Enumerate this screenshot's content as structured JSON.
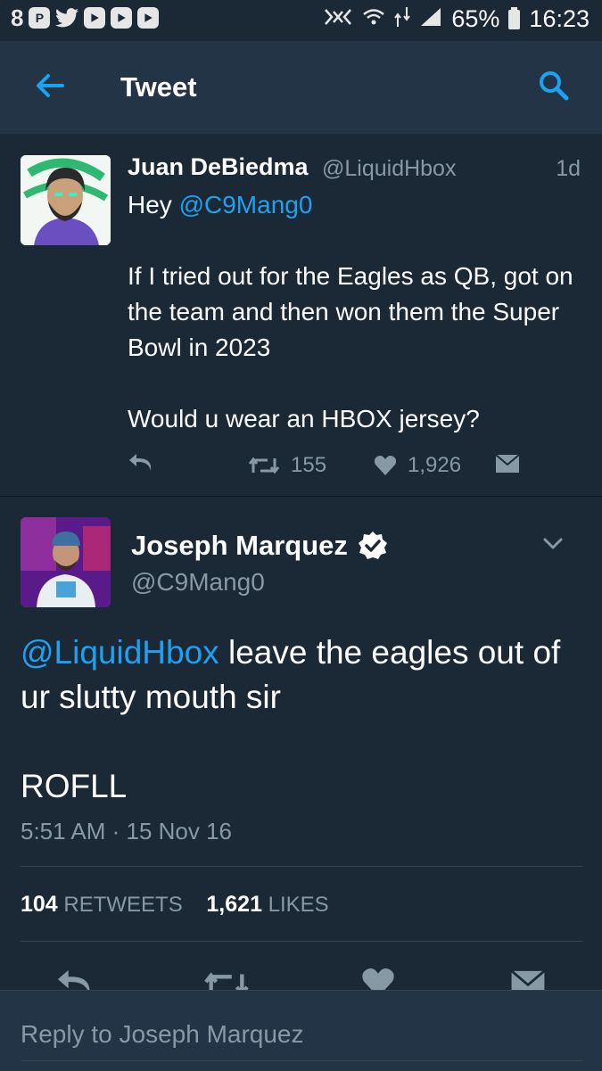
{
  "status_bar": {
    "apps": [
      "8",
      "P",
      "twitter",
      "youtube",
      "youtube",
      "youtube"
    ],
    "battery": "65%",
    "time": "16:23"
  },
  "app_bar": {
    "title": "Tweet",
    "icons": [
      "back-arrow-icon",
      "search-icon"
    ]
  },
  "parent_tweet": {
    "name": "Juan DeBiedma",
    "handle": "@LiquidHbox",
    "time": "1d",
    "body_prefix": "Hey ",
    "mention": "@C9Mang0",
    "paragraph_2": "If I tried out for the Eagles as QB, got on the team and then won them the Super Bowl in 2023",
    "paragraph_3": "Would u wear an HBOX jersey?",
    "retweets": "155",
    "likes": "1,926"
  },
  "main_tweet": {
    "name": "Joseph Marquez",
    "handle": "@C9Mang0",
    "mention": "@LiquidHbox",
    "body_rest": " leave the eagles out of ur slutty mouth sir",
    "paragraph_2": "ROFLL",
    "timestamp": "5:51 AM · 15 Nov 16",
    "retweet_count": "104",
    "retweet_label": "RETWEETS",
    "like_count": "1,621",
    "like_label": "LIKES"
  },
  "reply": {
    "placeholder": "Reply to Joseph Marquez"
  },
  "colors": {
    "background": "#1b2836",
    "app_bar": "#243447",
    "link": "#1da1f2",
    "muted": "#8899a6"
  }
}
